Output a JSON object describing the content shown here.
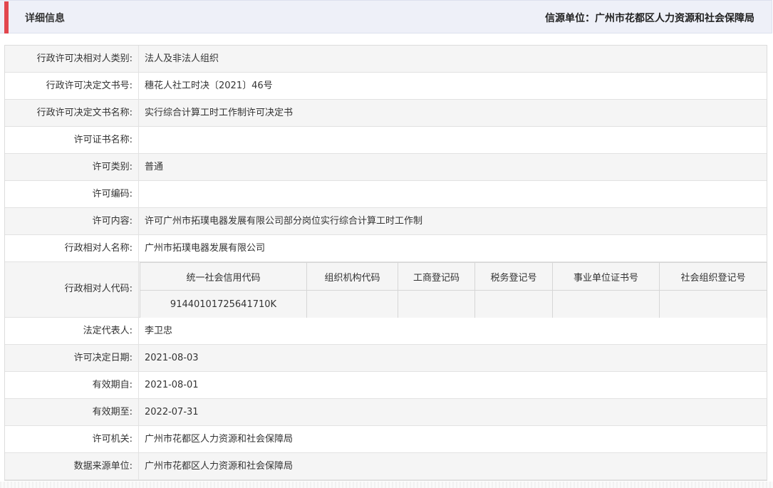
{
  "header": {
    "title": "详细信息",
    "source": "信源单位：广州市花都区人力资源和社会保障局"
  },
  "rows": [
    {
      "label": "行政许可决相对人类别:",
      "value": "法人及非法人组织"
    },
    {
      "label": "行政许可决定文书号:",
      "value": "穗花人社工时决〔2021〕46号"
    },
    {
      "label": "行政许可决定文书名称:",
      "value": "实行综合计算工时工作制许可决定书"
    },
    {
      "label": "许可证书名称:",
      "value": ""
    },
    {
      "label": "许可类别:",
      "value": "普通"
    },
    {
      "label": "许可编码:",
      "value": ""
    },
    {
      "label": "许可内容:",
      "value": "许可广州市拓璞电器发展有限公司部分岗位实行综合计算工时工作制"
    },
    {
      "label": "行政相对人名称:",
      "value": "广州市拓璞电器发展有限公司"
    }
  ],
  "code_row": {
    "label": "行政相对人代码:",
    "headers": [
      "统一社会信用代码",
      "组织机构代码",
      "工商登记码",
      "税务登记号",
      "事业单位证书号",
      "社会组织登记号"
    ],
    "values": [
      "91440101725641710K",
      "",
      "",
      "",
      "",
      ""
    ]
  },
  "rows_after": [
    {
      "label": "法定代表人:",
      "value": "李卫忠"
    },
    {
      "label": "许可决定日期:",
      "value": "2021-08-03"
    },
    {
      "label": "有效期自:",
      "value": "2021-08-01"
    },
    {
      "label": "有效期至:",
      "value": "2022-07-31"
    },
    {
      "label": "许可机关:",
      "value": "广州市花都区人力资源和社会保障局"
    },
    {
      "label": "数据来源单位:",
      "value": "广州市花都区人力资源和社会保障局"
    }
  ]
}
